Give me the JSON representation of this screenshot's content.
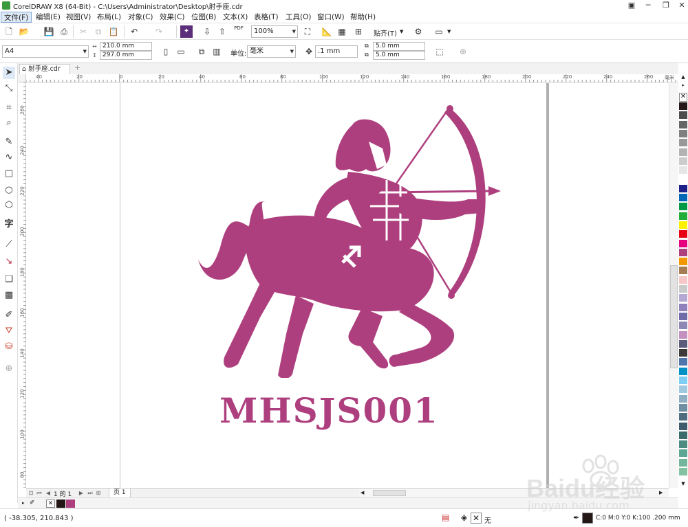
{
  "window": {
    "title": "CorelDRAW X8 (64-Bit) - C:\\Users\\Administrator\\Desktop\\射手座.cdr",
    "controls": [
      "─",
      "❐",
      "✕"
    ],
    "restore_icon": "▣"
  },
  "menu": [
    {
      "label": "文件(F)",
      "active": true
    },
    {
      "label": "编辑(E)"
    },
    {
      "label": "视图(V)"
    },
    {
      "label": "布局(L)"
    },
    {
      "label": "对象(C)"
    },
    {
      "label": "效果(C)"
    },
    {
      "label": "位图(B)"
    },
    {
      "label": "文本(X)"
    },
    {
      "label": "表格(T)"
    },
    {
      "label": "工具(O)"
    },
    {
      "label": "窗口(W)"
    },
    {
      "label": "帮助(H)"
    }
  ],
  "toolbar": {
    "zoom": "100%",
    "pdf_label": "PDF",
    "snap_label": "贴齐(T)"
  },
  "property_bar": {
    "page_size": "A4",
    "width": "210.0 mm",
    "height": "297.0 mm",
    "units_label": "单位:",
    "units": "毫米",
    "nudge": ".1 mm",
    "dup_x": "5.0 mm",
    "dup_y": "5.0 mm"
  },
  "document_tab": {
    "label": "射手座.cdr"
  },
  "rulers": {
    "h_labels": [
      "40",
      "20",
      "0",
      "20",
      "40",
      "60",
      "80",
      "100",
      "120",
      "140",
      "160",
      "180",
      "200",
      "220",
      "240",
      "260"
    ],
    "h_unit": "毫米",
    "v_labels": [
      "280",
      "260",
      "240",
      "220",
      "200",
      "180",
      "160",
      "140",
      "120",
      "100",
      "80",
      "60"
    ]
  },
  "artwork": {
    "text": "MHSJS001",
    "color": "#ae3f7e"
  },
  "page_nav": {
    "page_of": "1 的 1",
    "page_tab": "页 1"
  },
  "palette_colors": [
    "#231815",
    "#4d4d4d",
    "#666666",
    "#808080",
    "#999999",
    "#b3b3b3",
    "#cccccc",
    "#e6e6e6",
    "#ffffff",
    "#1d2088",
    "#0068b7",
    "#009944",
    "#22ac38",
    "#fff100",
    "#e60012",
    "#e4007f",
    "#ae3f7e",
    "#f39800",
    "#a67c52",
    "#f7c6c7",
    "#c9caca",
    "#b5a8d3",
    "#8f82bc",
    "#6f6ba8",
    "#8c87b4",
    "#c490bf",
    "#5b5b7b",
    "#3e3a39",
    "#4f75ad",
    "#0092c7",
    "#7ecef4",
    "#a0c8df",
    "#8fb0c2",
    "#6e8ea3",
    "#4f6d80",
    "#3e5c6e",
    "#3b6b6a",
    "#4c8b7f",
    "#5fa795",
    "#73b69b",
    "#82c2a0"
  ],
  "doc_palette": [
    "#ffffff",
    "#231815",
    "#ae3f7e"
  ],
  "status": {
    "coords": "( -38.305, 210.843 )",
    "fill_none": "无",
    "outline_info": "C:0 M:0 Y:0 K:100  .200 mm"
  },
  "watermark": {
    "brand": "Baidu经验",
    "url": "jingyan.baidu.com"
  }
}
